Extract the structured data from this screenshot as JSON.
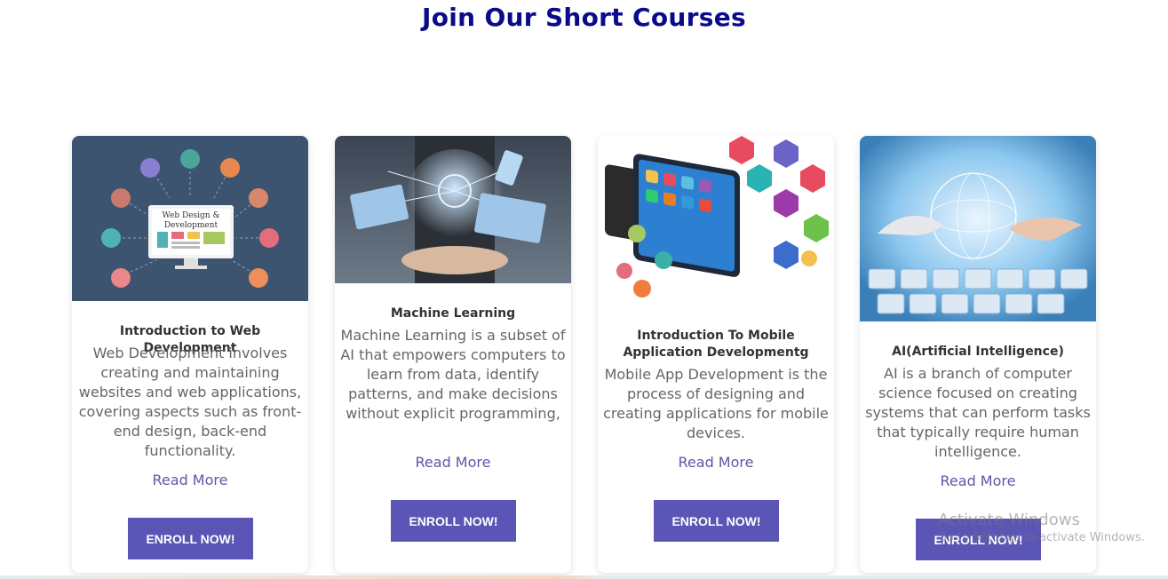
{
  "page": {
    "title": "Join Our Short Courses"
  },
  "courses": [
    {
      "image_icon": "web-design-illustration",
      "image_caption_line1": "Web Design &",
      "image_caption_line2": "Development",
      "title": "Introduction to Web Development",
      "description": "Web Development involves creating and maintaining websites and web applications, covering aspects such as front-end design, back-end functionality.",
      "read_more": "Read More",
      "button": "ENROLL NOW!"
    },
    {
      "image_icon": "machine-learning-photo",
      "title": "Machine Learning",
      "description": "Machine Learning is a subset of AI that empowers computers to learn from data, identify patterns, and make decisions without explicit programming,",
      "read_more": "Read More",
      "button": "ENROLL NOW!"
    },
    {
      "image_icon": "mobile-apps-illustration",
      "title": "Introduction To Mobile Application Developmentg",
      "description": "Mobile App Development is the process of designing and creating applications for mobile devices.",
      "read_more": "Read More",
      "button": "ENROLL NOW!"
    },
    {
      "image_icon": "ai-robot-hand-photo",
      "title": "AI(Artificial Intelligence)",
      "description": "AI is a branch of computer science focused on creating systems that can perform tasks that typically require human intelligence.",
      "read_more": "Read More",
      "button": "ENROLL NOW!"
    }
  ],
  "watermark": {
    "line1": "Activate Windows",
    "line2": "Go to Settings to activate Windows."
  },
  "colors": {
    "title": "#0b0b8a",
    "button": "#5b56b5",
    "link": "#5a58a8"
  }
}
